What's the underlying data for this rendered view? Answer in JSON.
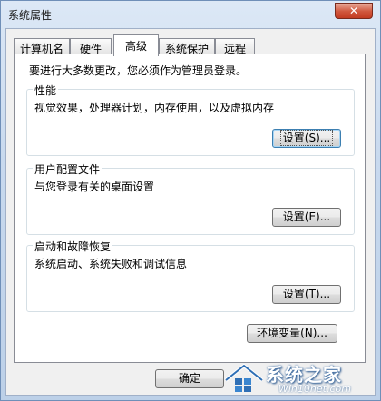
{
  "window": {
    "title": "系统属性"
  },
  "tabs": [
    {
      "label": "计算机名"
    },
    {
      "label": "硬件"
    },
    {
      "label": "高级"
    },
    {
      "label": "系统保护"
    },
    {
      "label": "远程"
    }
  ],
  "active_tab": "高级",
  "notice": "要进行大多数更改，您必须作为管理员登录。",
  "groups": {
    "performance": {
      "title": "性能",
      "desc": "视觉效果，处理器计划，内存使用，以及虚拟内存",
      "button": "设置(S)..."
    },
    "profiles": {
      "title": "用户配置文件",
      "desc": "与您登录有关的桌面设置",
      "button": "设置(E)..."
    },
    "startup": {
      "title": "启动和故障恢复",
      "desc": "系统启动、系统失败和调试信息",
      "button": "设置(T)..."
    }
  },
  "env_button": "环境变量(N)...",
  "ok_button": "确定",
  "watermark": {
    "brand": "系统之家",
    "site": "Win10net.com"
  },
  "colors": {
    "close_button": "#d0563c",
    "focus_border": "#3c7fb1"
  }
}
